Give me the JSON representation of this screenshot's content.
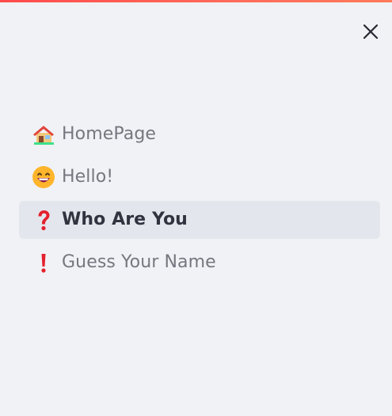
{
  "sidebar": {
    "close_icon": "close-icon",
    "items": [
      {
        "label": "HomePage",
        "icon": "house-icon",
        "active": false
      },
      {
        "label": "Hello!",
        "icon": "grinning-face-icon",
        "active": false
      },
      {
        "label": "Who Are You",
        "icon": "red-question-mark-icon",
        "active": true
      },
      {
        "label": "Guess Your Name",
        "icon": "red-exclamation-mark-icon",
        "active": false
      }
    ]
  },
  "colors": {
    "background": "#f0f2f6",
    "accent_top_bar": "#ff4b4b",
    "active_item_bg": "#e3e6ec",
    "text_inactive": "#76777f",
    "text_active": "#31333f"
  }
}
